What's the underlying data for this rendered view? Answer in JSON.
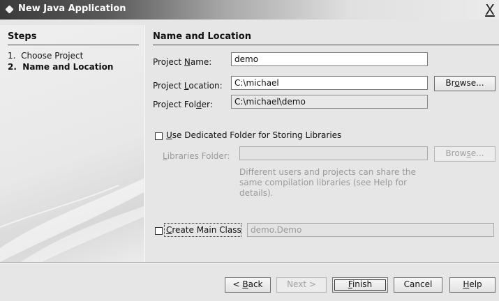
{
  "window": {
    "title": "New Java Application",
    "close_glyph": "X"
  },
  "steps": {
    "heading": "Steps",
    "items": [
      {
        "number": "1.",
        "label": "Choose Project"
      },
      {
        "number": "2.",
        "label": "Name and Location"
      }
    ],
    "current_index": 1
  },
  "section": {
    "heading": "Name and Location"
  },
  "form": {
    "project_name": {
      "label_pre": "Project ",
      "label_key": "N",
      "label_post": "ame:",
      "value": "demo"
    },
    "project_location": {
      "label_pre": "Project ",
      "label_key": "L",
      "label_post": "ocation:",
      "value": "C:\\michael"
    },
    "project_folder": {
      "label_pre": "Project Fol",
      "label_key": "d",
      "label_post": "er:",
      "value": "C:\\michael\\demo"
    },
    "browse_location": {
      "pre": "Br",
      "key": "o",
      "post": "wse..."
    },
    "dedicated_folder": {
      "key": "U",
      "post": "se Dedicated Folder for Storing Libraries",
      "checked": false
    },
    "libraries_folder": {
      "key": "L",
      "post": "ibraries Folder:",
      "value": ""
    },
    "browse_libraries": {
      "pre": "Brow",
      "key": "s",
      "post": "e..."
    },
    "help_text": "Different users and projects can share the same compilation libraries (see Help for details).",
    "create_main_class": {
      "key": "C",
      "post": "reate Main Class",
      "checked": false,
      "value": "demo.Demo"
    }
  },
  "buttons": {
    "back": {
      "pre": "< ",
      "key": "B",
      "post": "ack"
    },
    "next": {
      "label": "Next >"
    },
    "finish": {
      "key": "F",
      "post": "inish"
    },
    "cancel": {
      "label": "Cancel"
    },
    "help": {
      "key": "H",
      "post": "elp"
    }
  },
  "colors": {
    "title_bar_dark": "#3a3a3a",
    "panel_background": "#e6e6e6",
    "disabled_text": "#9a9a9a"
  }
}
